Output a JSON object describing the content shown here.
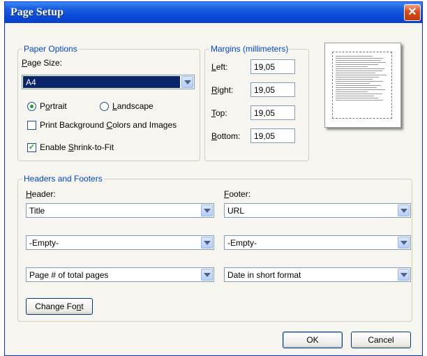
{
  "title": "Page Setup",
  "paper_options": {
    "legend": "Paper Options",
    "page_size_label": "Page Size:",
    "page_size_value": "A4",
    "portrait_label": "Portrait",
    "landscape_label": "Landscape",
    "orientation_selected": "Portrait",
    "print_bg_label": "Print Background Colors and Images",
    "print_bg_checked": false,
    "shrink_label": "Enable Shrink-to-Fit",
    "shrink_checked": true
  },
  "margins": {
    "legend": "Margins (millimeters)",
    "left_label": "Left:",
    "left_value": "19,05",
    "right_label": "Right:",
    "right_value": "19,05",
    "top_label": "Top:",
    "top_value": "19,05",
    "bottom_label": "Bottom:",
    "bottom_value": "19,05"
  },
  "headers_footers": {
    "legend": "Headers and Footers",
    "header_label": "Header:",
    "footer_label": "Footer:",
    "header_values": [
      "Title",
      "-Empty-",
      "Page # of total pages"
    ],
    "footer_values": [
      "URL",
      "-Empty-",
      "Date in short format"
    ],
    "change_font_label": "Change Font"
  },
  "buttons": {
    "ok": "OK",
    "cancel": "Cancel"
  },
  "colors": {
    "titlebar": "#0a4ad8",
    "legend_text": "#0046d5",
    "selection": "#0a246a",
    "check_mark": "#21a121"
  }
}
